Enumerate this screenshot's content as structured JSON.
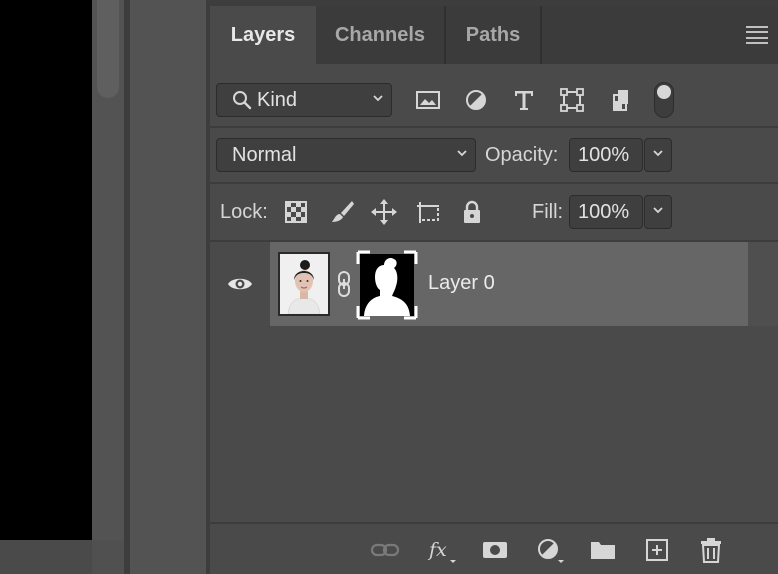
{
  "tabs": [
    {
      "label": "Layers",
      "active": true
    },
    {
      "label": "Channels",
      "active": false
    },
    {
      "label": "Paths",
      "active": false
    }
  ],
  "filter": {
    "kind_label": "Kind",
    "tools": [
      "image-filter-icon",
      "adjustment-filter-icon",
      "type-filter-icon",
      "shape-filter-icon",
      "smart-object-filter-icon"
    ]
  },
  "blend": {
    "mode": "Normal",
    "opacity_label": "Opacity:",
    "opacity_value": "100%"
  },
  "lock": {
    "label": "Lock:",
    "fill_label": "Fill:",
    "fill_value": "100%",
    "tools": [
      "lock-transparent-pixels-icon",
      "lock-image-pixels-icon",
      "lock-position-icon",
      "lock-artboard-icon",
      "lock-all-icon"
    ]
  },
  "layers": [
    {
      "name": "Layer 0",
      "visible": true,
      "has_mask": true,
      "selected": true
    }
  ],
  "bottom_tools": [
    "link-layers-icon",
    "fx-icon",
    "add-mask-icon",
    "adjustment-layer-icon",
    "new-group-icon",
    "new-layer-icon",
    "delete-layer-icon"
  ],
  "colors": {
    "panel_bg": "#4a4a4a",
    "selected_row": "#666666",
    "canvas": "#000000"
  }
}
